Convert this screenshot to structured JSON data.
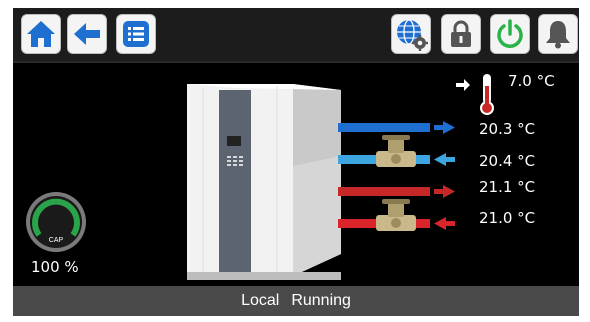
{
  "toolbar": {
    "left_buttons": [
      "home-icon",
      "back-arrow-icon",
      "menu-list-icon"
    ],
    "right_buttons": [
      "network-settings-icon",
      "lock-icon",
      "power-icon",
      "bell-icon"
    ]
  },
  "colors": {
    "accent_blue": "#1f6fd1",
    "supply_blue": "#3da5e0",
    "pipe_red": "#d9252a",
    "power_green": "#2bb34a",
    "gauge_green": "#2aa34a"
  },
  "outdoor": {
    "temperature": "7.0 °C"
  },
  "circuits": [
    {
      "temperature": "20.3 °C",
      "direction": "out",
      "color": "blue"
    },
    {
      "temperature": "20.4 °C",
      "direction": "in",
      "color": "blue"
    },
    {
      "temperature": "21.1 °C",
      "direction": "out",
      "color": "red"
    },
    {
      "temperature": "21.0 °C",
      "direction": "in",
      "color": "red"
    }
  ],
  "gauge": {
    "label": "CAP",
    "value": "100 %",
    "fraction": 1.0
  },
  "status": {
    "mode": "Local",
    "state": "Running"
  }
}
